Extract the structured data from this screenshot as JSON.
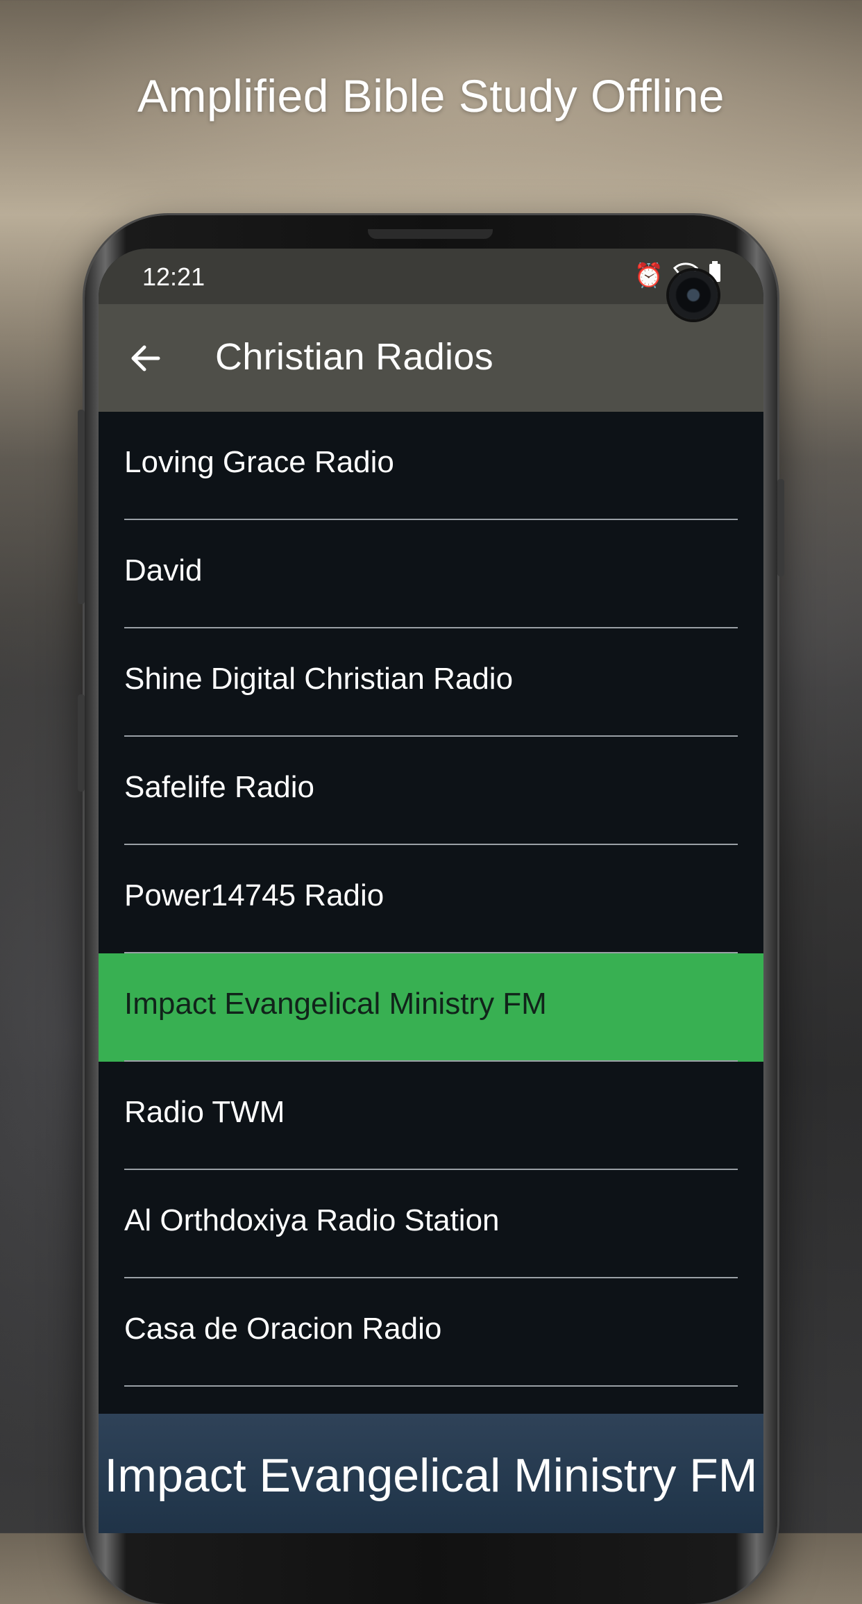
{
  "promo": {
    "title": "Amplified Bible Study Offline"
  },
  "status_bar": {
    "time": "12:21",
    "icons": [
      "alarm-icon",
      "wifi-icon",
      "battery-icon"
    ]
  },
  "app_bar": {
    "title": "Christian Radios",
    "back_icon": "arrow-left-icon"
  },
  "stations": [
    {
      "label": "Loving Grace Radio",
      "selected": false
    },
    {
      "label": "David",
      "selected": false
    },
    {
      "label": "Shine Digital Christian Radio",
      "selected": false
    },
    {
      "label": "Safelife Radio",
      "selected": false
    },
    {
      "label": "Power14745 Radio",
      "selected": false
    },
    {
      "label": "Impact Evangelical Ministry FM",
      "selected": true
    },
    {
      "label": "Radio TWM",
      "selected": false
    },
    {
      "label": "Al Orthdoxiya Radio Station",
      "selected": false
    },
    {
      "label": "Casa de Oracion Radio",
      "selected": false
    }
  ],
  "now_playing": {
    "title": "Impact Evangelical Ministry FM"
  },
  "colors": {
    "selected": "#38b052",
    "list_bg": "#0d1217",
    "app_bar": "#4f4f49",
    "status_bar": "#3c3c38"
  }
}
